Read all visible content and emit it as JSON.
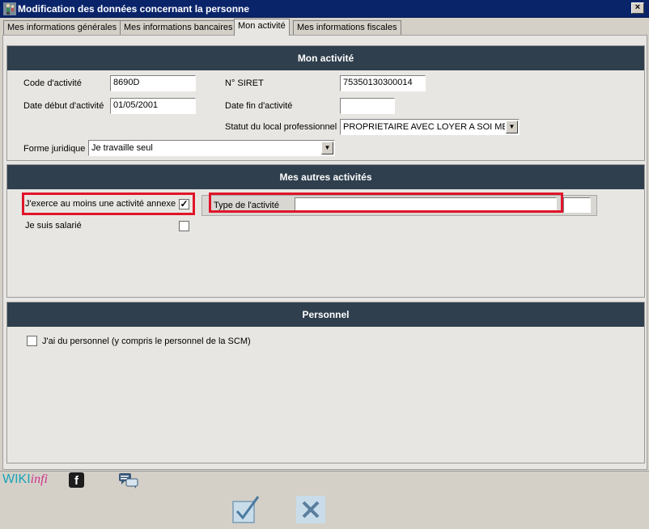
{
  "window": {
    "title": "Modification des données concernant la personne",
    "close_label": "×"
  },
  "tabs": [
    {
      "label": "Mes informations générales",
      "active": false
    },
    {
      "label": "Mes informations bancaires",
      "active": false
    },
    {
      "label": "Mon activité",
      "active": true
    },
    {
      "label": "Mes informations fiscales",
      "active": false
    }
  ],
  "mon_activite": {
    "header": "Mon activité",
    "code_activite_label": "Code d'activité",
    "code_activite_value": "8690D",
    "siret_label": "N° SIRET",
    "siret_value": "75350130300014",
    "date_debut_label": "Date début d'activité",
    "date_debut_value": "01/05/2001",
    "date_fin_label": "Date fin d'activité",
    "date_fin_value": "",
    "statut_local_label": "Statut du local professionnel",
    "statut_local_value": "PROPRIETAIRE AVEC LOYER A SOI MEME",
    "forme_juridique_label": "Forme juridique",
    "forme_juridique_value": "Je travaille seul"
  },
  "autres_activites": {
    "header": "Mes autres activités",
    "annexe_label": "J'exerce au moins une activité annexe",
    "annexe_checked": true,
    "salarie_label": "Je suis salarié",
    "salarie_checked": false,
    "type_label": "Type de l'activité",
    "type_value": ""
  },
  "personnel": {
    "header": "Personnel",
    "personnel_label": "J'ai du personnel (y compris le personnel de la SCM)",
    "personnel_checked": false
  },
  "footer": {
    "wiki_part1": "WIKI",
    "wiki_part2": "infi",
    "facebook_glyph": "f",
    "check_glyph": "✓",
    "unchecked_glyph": ""
  },
  "colors": {
    "section_header_bg": "#2f3f4d",
    "highlight_red": "#e0142a",
    "titlebar_bg": "#0a246a"
  }
}
